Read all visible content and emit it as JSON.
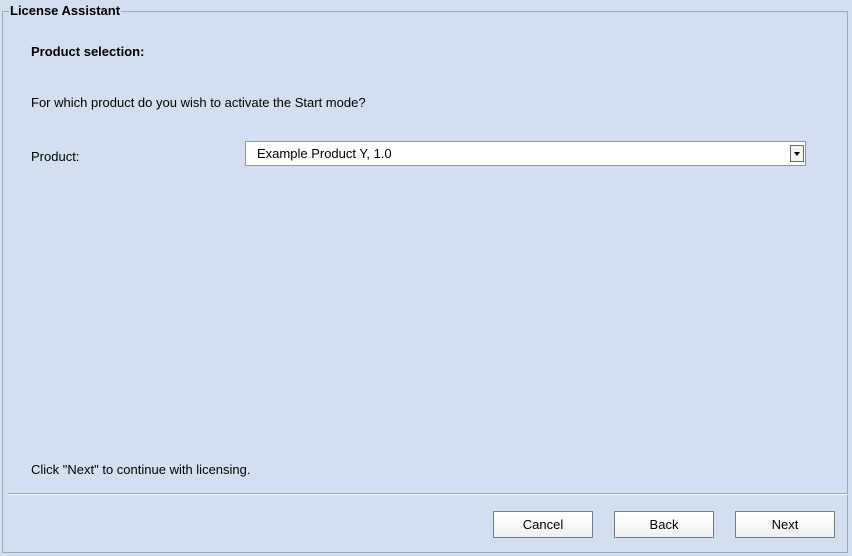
{
  "dialog": {
    "title": "License Assistant",
    "section_heading": "Product selection:",
    "question": "For which product do you wish to activate the Start mode?",
    "product_label": "Product:",
    "product_select": {
      "selected_value": "Example Product Y, 1.0",
      "arrow_icon": "chevron-down-icon"
    },
    "hint": "Click \"Next\" to continue with licensing."
  },
  "buttons": {
    "cancel_label": "Cancel",
    "back_label": "Back",
    "next_label": "Next"
  },
  "colors": {
    "background": "#d3dff0",
    "border": "#a3a9b1",
    "field_background": "#ffffff"
  }
}
